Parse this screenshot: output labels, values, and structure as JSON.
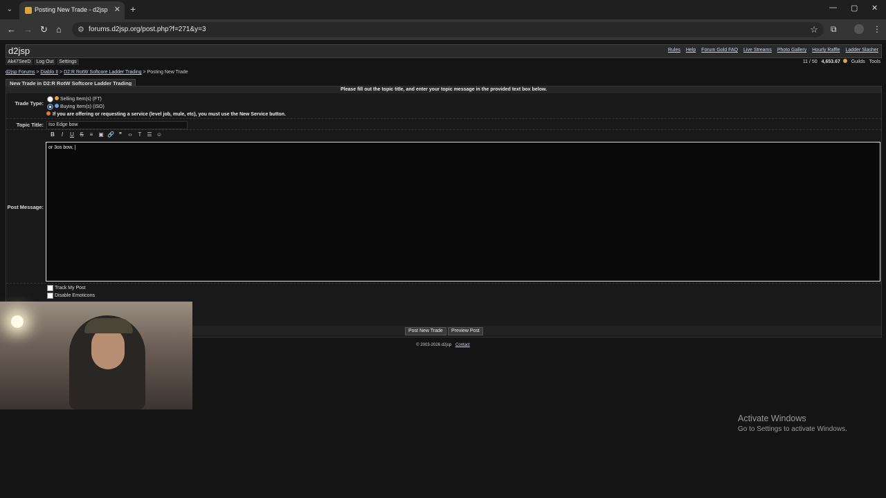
{
  "browser": {
    "tab_title": "Posting New Trade - d2jsp",
    "new_tab": "+",
    "url": "forums.d2jsp.org/post.php?f=271&y=3",
    "window_controls": {
      "minimize": "—",
      "restore": "▢",
      "close": "✕"
    }
  },
  "site": {
    "logo": "d2jsp",
    "top_links": [
      "Rules",
      "Help",
      "Forum Gold FAQ",
      "Live Streams",
      "Photo Gallery",
      "Hourly Raffle",
      "Ladder Slasher"
    ],
    "user_links": [
      "Ak47SeeD",
      "Log Out",
      "Settings"
    ],
    "counter": "11 / 50",
    "gold": "4,653.67",
    "right_links": [
      "Guilds",
      "Tools"
    ]
  },
  "breadcrumb": {
    "items": [
      "d2jsp Forums",
      "Diablo II",
      "D2:R RotW Softcore Ladder Trading"
    ],
    "separator": ">",
    "current": "Posting New Trade"
  },
  "form": {
    "tab_label": "New Trade in D2:R RotW Softcore Ladder Trading",
    "header": "Please fill out the topic title, and enter your topic message in the provided text box below.",
    "trade_type_label": "Trade Type:",
    "options": [
      {
        "label": "Selling Item(s) (FT)",
        "selected": false
      },
      {
        "label": "Buying Item(s) (ISO)",
        "selected": true
      }
    ],
    "notice": "If you are offering or requesting a service (level job, mule, etc), you must use the New Service button.",
    "topic_title_label": "Topic Title:",
    "topic_title_value": "Iso Edge bow",
    "post_message_label": "Post Message:",
    "message_value": "or 3os bow, |",
    "editor_tools": [
      "B",
      "I",
      "U",
      "S",
      "≡",
      "▣",
      "🔗",
      "❞",
      "‹›",
      "T",
      "☰",
      "☺"
    ],
    "checkboxes": [
      "Track My Post",
      "Disable Emoticons"
    ],
    "buttons": {
      "post": "Post New Trade",
      "preview": "Preview Post"
    }
  },
  "footer": {
    "copyright": "© 2003-2026 d2jsp",
    "contact": "Contact"
  },
  "os_overlay": {
    "line1": "Activate Windows",
    "line2": "Go to Settings to activate Windows."
  }
}
